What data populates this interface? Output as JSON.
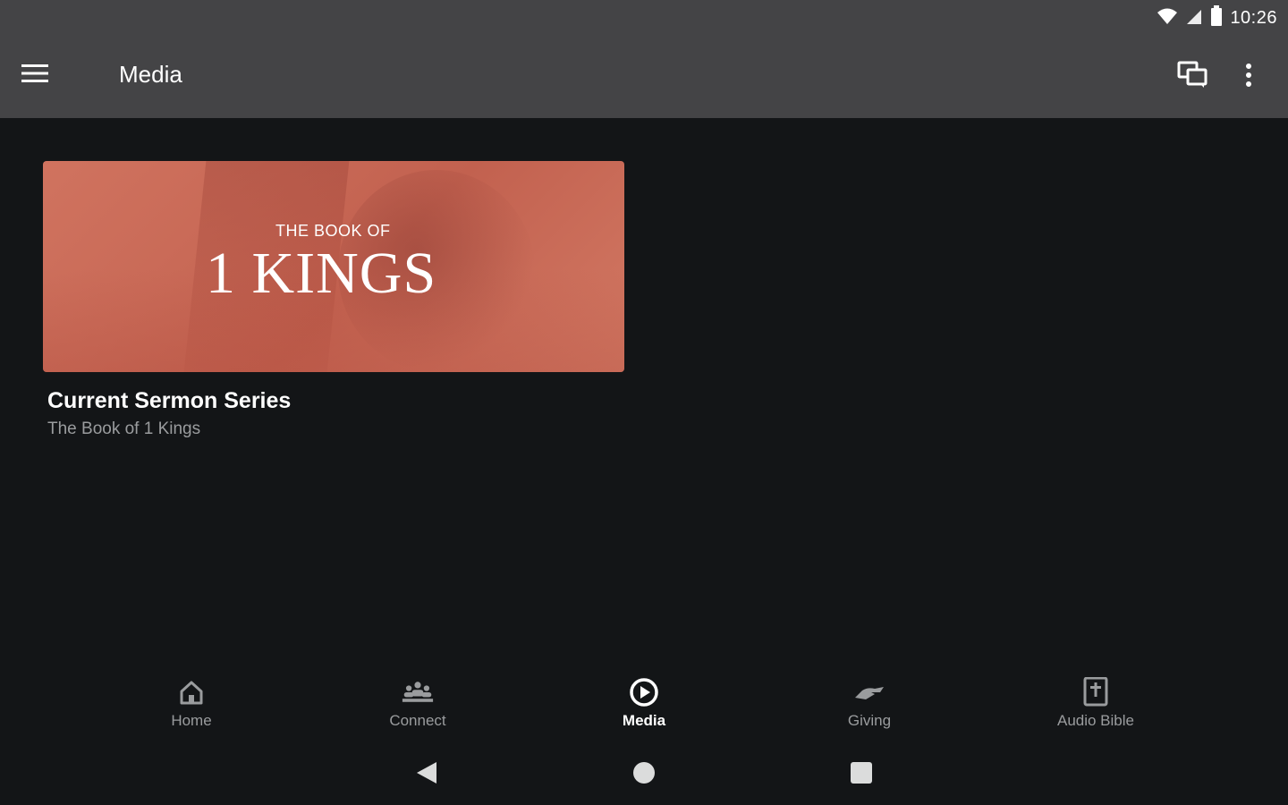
{
  "status_bar": {
    "time": "10:26",
    "icons": [
      "wifi-icon",
      "signal-icon",
      "battery-icon"
    ]
  },
  "app_bar": {
    "menu_icon": "hamburger-menu-icon",
    "title": "Media",
    "actions": [
      {
        "icon": "chat-icon"
      },
      {
        "icon": "more-vert-icon"
      }
    ]
  },
  "main": {
    "card": {
      "image_text_small": "THE BOOK OF",
      "image_text_large": "1 KINGS",
      "title": "Current Sermon Series",
      "subtitle": "The Book of 1 Kings"
    }
  },
  "bottom_nav": {
    "items": [
      {
        "label": "Home",
        "icon": "home-icon",
        "active": false
      },
      {
        "label": "Connect",
        "icon": "people-icon",
        "active": false
      },
      {
        "label": "Media",
        "icon": "play-circle-icon",
        "active": true
      },
      {
        "label": "Giving",
        "icon": "giving-hand-icon",
        "active": false
      },
      {
        "label": "Audio Bible",
        "icon": "bible-icon",
        "active": false
      }
    ]
  },
  "system_nav": {
    "buttons": [
      "back-icon",
      "home-circle-icon",
      "recents-icon"
    ]
  },
  "colors": {
    "app_bar": "#444446",
    "background": "#131517",
    "card_accent": "#cd705c",
    "muted_text": "#9a9c9e"
  }
}
